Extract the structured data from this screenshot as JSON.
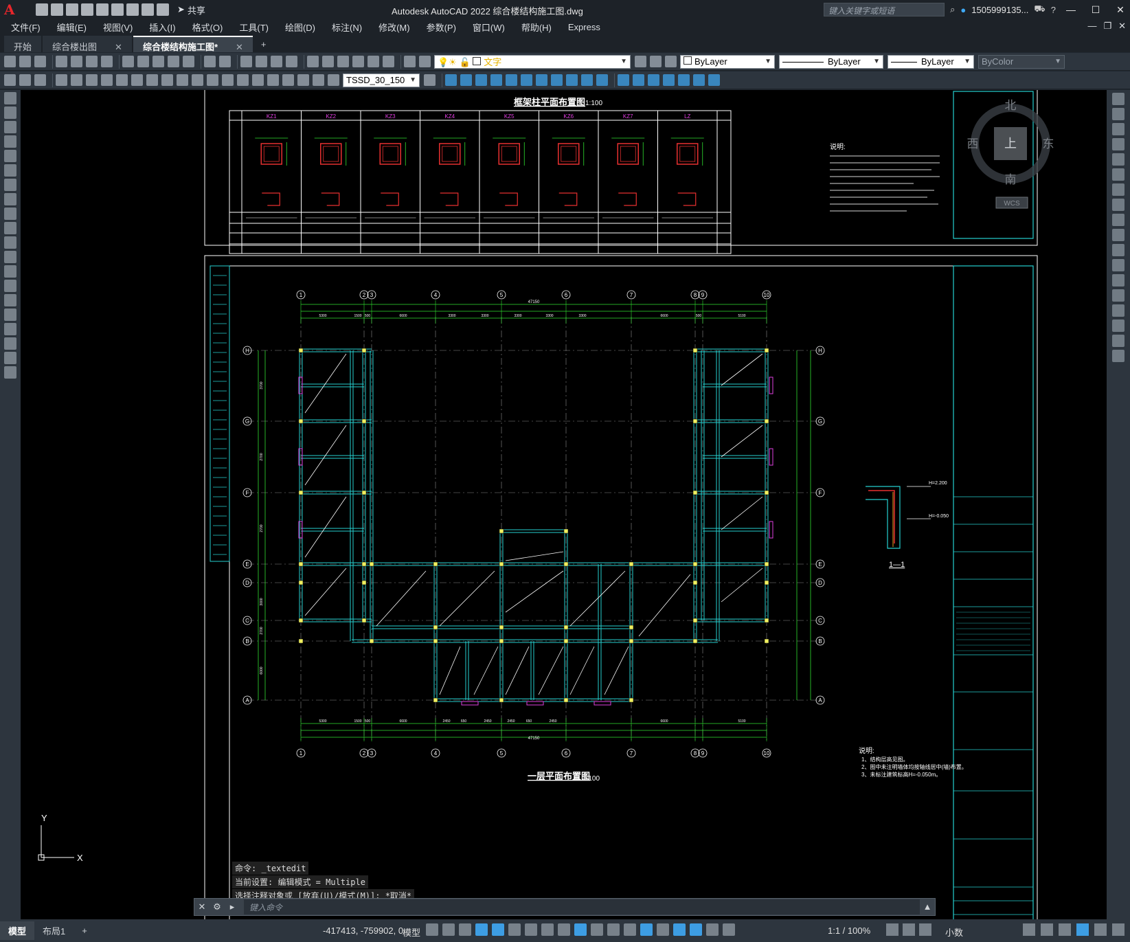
{
  "app": {
    "logo": "A",
    "title": "Autodesk AutoCAD 2022    综合楼结构施工图.dwg",
    "search_placeholder": "键入关键字或短语",
    "user": "1505999135...",
    "share": "共享"
  },
  "menu": [
    "文件(F)",
    "编辑(E)",
    "视图(V)",
    "插入(I)",
    "格式(O)",
    "工具(T)",
    "绘图(D)",
    "标注(N)",
    "修改(M)",
    "参数(P)",
    "窗口(W)",
    "帮助(H)",
    "Express"
  ],
  "tabs": [
    {
      "label": "开始",
      "closable": false,
      "active": false
    },
    {
      "label": "综合楼出图",
      "closable": true,
      "active": false
    },
    {
      "label": "综合楼结构施工图*",
      "closable": true,
      "active": true
    }
  ],
  "toolbar": {
    "layer": "文字",
    "color": "ByLayer",
    "linetype": "ByLayer",
    "lineweight": "ByLayer",
    "plotstyle": "ByColor",
    "textstyle": "TSSD_30_150"
  },
  "drawing": {
    "top_title": "框架柱平面布置图",
    "top_scale": "1:100",
    "column_labels": [
      "KZ1",
      "KZ2",
      "KZ3",
      "KZ4",
      "KZ5",
      "KZ6",
      "KZ7",
      "LZ"
    ],
    "notes_title": "说明:",
    "plan_title": "一层平面布置图",
    "plan_scale": "1:100",
    "section_label": "1—1",
    "total_dim": "47150",
    "grid_cols": [
      "1",
      "2",
      "3",
      "4",
      "5",
      "6",
      "7",
      "8",
      "9",
      "10"
    ],
    "grid_rows": [
      "H",
      "G",
      "F",
      "E",
      "D",
      "C",
      "B",
      "A"
    ],
    "notes2_title": "说明:",
    "notes2": [
      "1、结构层高见图。",
      "2、图中未注明墙体均按轴线居中(墙)布置。",
      "3、未标注建筑标高H=-0.050m。"
    ],
    "elev1": "H=2.200",
    "elev2": "H=-0.050",
    "dims_top": [
      "5300",
      "1500",
      "500",
      "6600",
      "3300",
      "3300",
      "3300",
      "3300",
      "3300",
      "6600",
      "500",
      "5100"
    ],
    "dims_bottom": [
      "5300",
      "1500",
      "500",
      "6600",
      "2450",
      "650",
      "2450",
      "2450",
      "650",
      "2450",
      "6600",
      "5100"
    ],
    "dims_left": [
      "3700",
      "2700",
      "2700",
      "3000",
      "2700",
      "6000"
    ]
  },
  "viewcube": {
    "north": "北",
    "south": "南",
    "east": "东",
    "west": "西",
    "top": "上",
    "wcs": "WCS"
  },
  "ucs": {
    "x": "X",
    "y": "Y"
  },
  "commands": [
    "命令: _textedit",
    "当前设置: 编辑模式 = Multiple",
    "选择注释对象或 [放弃(U)/模式(M)]: *取消*"
  ],
  "command_placeholder": "键入命令",
  "status": {
    "tabs": [
      "模型",
      "布局1"
    ],
    "coords": "-417413, -759902, 0",
    "mode": "模型",
    "scale": "1:1 / 100%",
    "units": "小数"
  }
}
